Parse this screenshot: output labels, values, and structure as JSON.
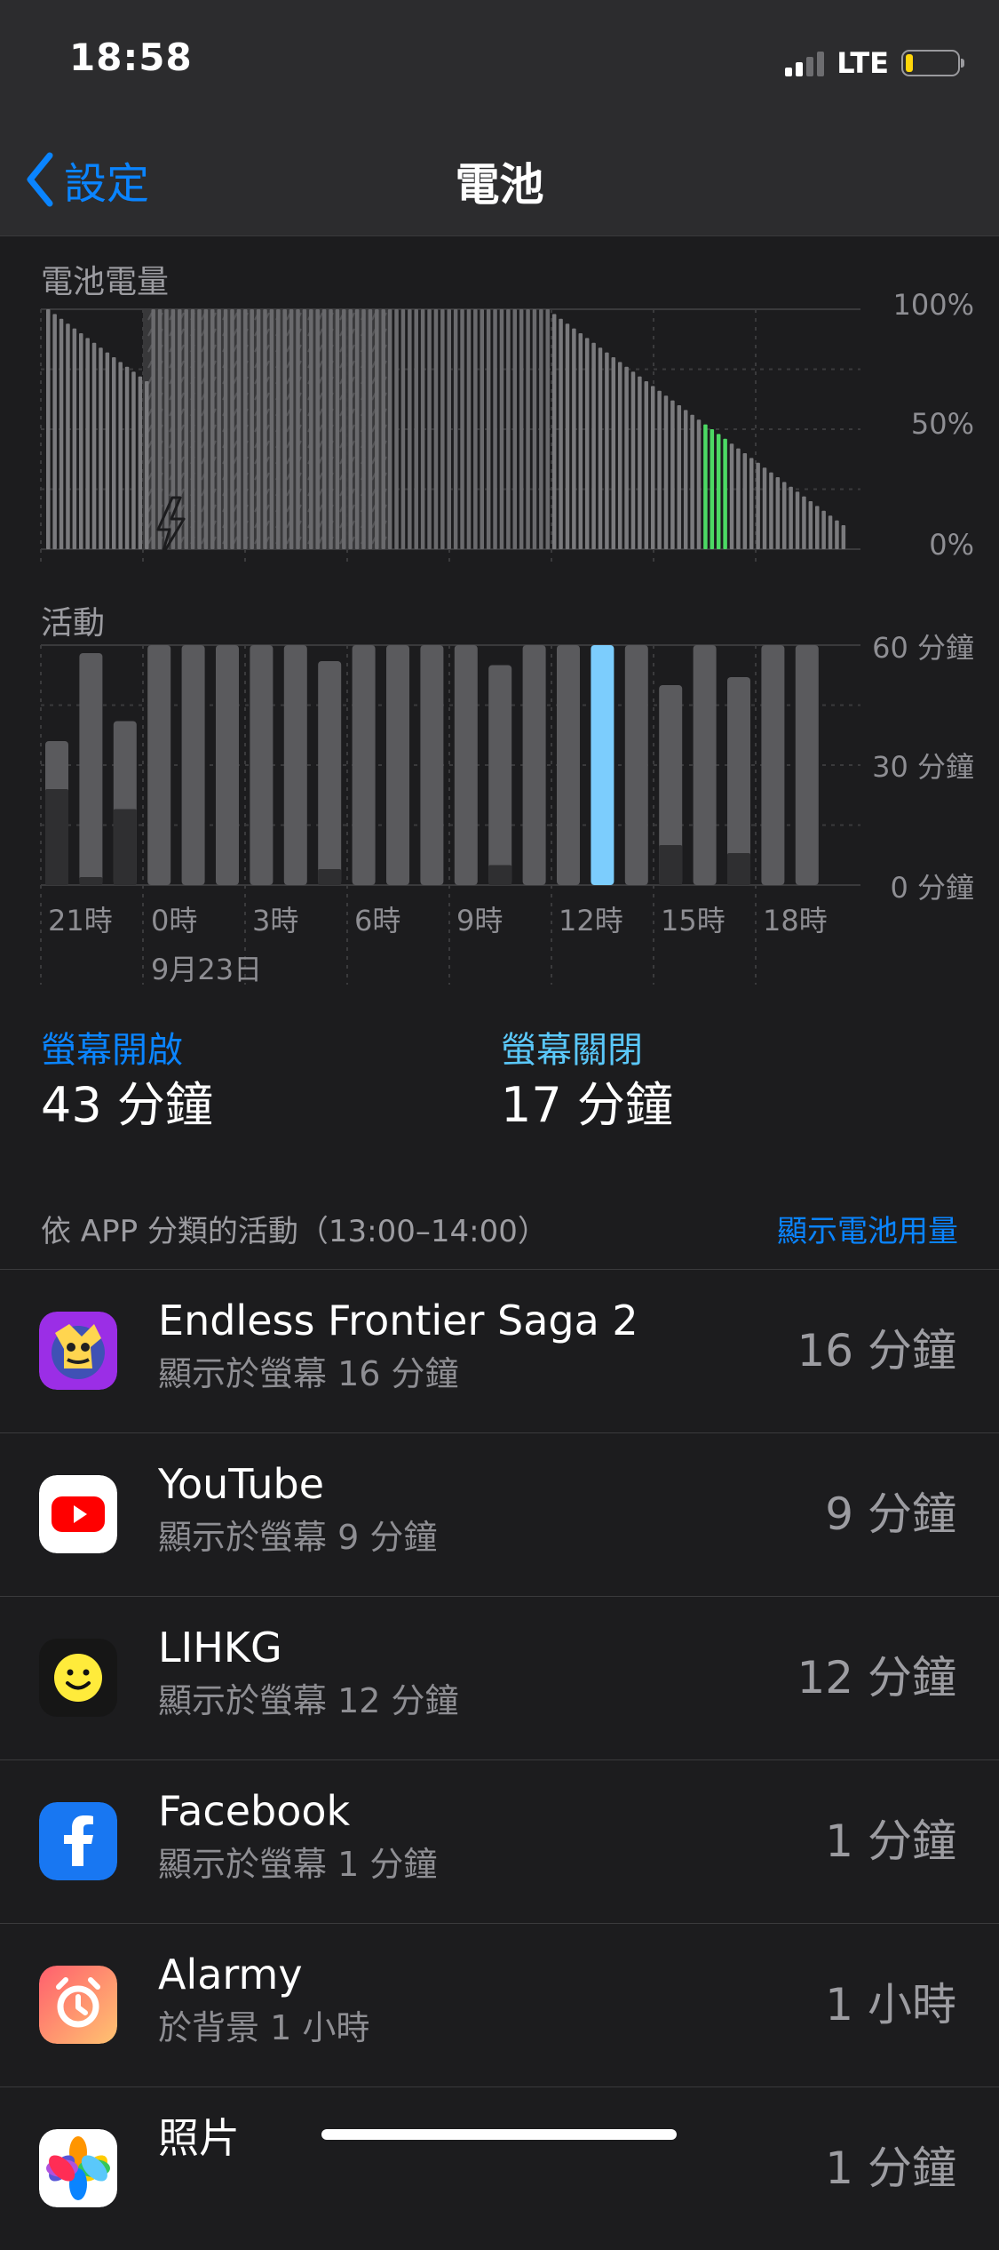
{
  "status": {
    "time": "18:58",
    "network": "LTE"
  },
  "nav": {
    "back_label": "設定",
    "title": "電池"
  },
  "sections": {
    "battery_label": "電池電量",
    "activity_label": "活動"
  },
  "battery_axis": [
    "100%",
    "50%",
    "0%"
  ],
  "activity_axis": [
    "60 分鐘",
    "30 分鐘",
    "0 分鐘"
  ],
  "x_axis": [
    "21時",
    "0時",
    "3時",
    "6時",
    "9時",
    "12時",
    "15時",
    "18時"
  ],
  "date_label": "9月23日",
  "screen": {
    "on_label": "螢幕開啟",
    "on_value": "43 分鐘",
    "off_label": "螢幕關閉",
    "off_value": "17 分鐘"
  },
  "apps_header": {
    "title": "依 APP 分類的活動（13:00–14:00）",
    "link": "顯示電池用量"
  },
  "apps": [
    {
      "name": "Endless Frontier Saga 2",
      "detail": "顯示於螢幕 16 分鐘",
      "value": "16 分鐘",
      "icon": "game-icon"
    },
    {
      "name": "YouTube",
      "detail": "顯示於螢幕 9 分鐘",
      "value": "9 分鐘",
      "icon": "youtube-icon"
    },
    {
      "name": "LIHKG",
      "detail": "顯示於螢幕 12 分鐘",
      "value": "12 分鐘",
      "icon": "lihkg-icon"
    },
    {
      "name": "Facebook",
      "detail": "顯示於螢幕 1 分鐘",
      "value": "1 分鐘",
      "icon": "facebook-icon"
    },
    {
      "name": "Alarmy",
      "detail": "於背景 1 小時",
      "value": "1 小時",
      "icon": "alarm-icon"
    },
    {
      "name": "照片",
      "detail": "",
      "value": "1 分鐘",
      "icon": "photos-icon"
    }
  ],
  "colors": {
    "accent": "#0a84ff",
    "screen_off": "#5ac8fa",
    "battery_highlight": "#4cd964",
    "activity_highlight": "#0a84ff"
  },
  "chart_data": [
    {
      "type": "bar",
      "title": "電池電量",
      "y_ticks": [
        "100%",
        "50%",
        "0%"
      ],
      "x_ticks": [
        "21時",
        "0時",
        "3時",
        "6時",
        "9時",
        "12時",
        "15時",
        "18時"
      ],
      "ylim": [
        0,
        100
      ],
      "values": [
        100,
        98,
        96,
        94,
        92,
        90,
        88,
        86,
        84,
        82,
        80,
        78,
        76,
        74,
        72,
        70,
        100,
        100,
        100,
        100,
        100,
        100,
        100,
        100,
        100,
        100,
        100,
        100,
        100,
        100,
        100,
        100,
        100,
        100,
        100,
        100,
        100,
        100,
        100,
        100,
        100,
        100,
        100,
        100,
        100,
        100,
        100,
        100,
        100,
        100,
        100,
        100,
        100,
        100,
        100,
        100,
        100,
        100,
        100,
        100,
        100,
        100,
        100,
        100,
        100,
        100,
        100,
        100,
        100,
        100,
        100,
        100,
        100,
        100,
        100,
        100,
        100,
        98,
        96,
        94,
        92,
        90,
        88,
        86,
        84,
        82,
        80,
        78,
        76,
        74,
        72,
        70,
        68,
        66,
        64,
        62,
        60,
        58,
        56,
        54,
        52,
        50,
        48,
        46,
        44,
        42,
        40,
        38,
        36,
        34,
        32,
        30,
        28,
        26,
        24,
        22,
        20,
        18,
        16,
        14,
        12,
        10
      ],
      "charging_range": [
        16,
        77
      ],
      "highlight_range": [
        100,
        104
      ]
    },
    {
      "type": "bar",
      "title": "活動",
      "y_ticks": [
        "60 分鐘",
        "30 分鐘",
        "0 分鐘"
      ],
      "x_ticks": [
        "21時",
        "0時",
        "3時",
        "6時",
        "9時",
        "12時",
        "15時",
        "18時"
      ],
      "ylim": [
        0,
        60
      ],
      "series": [
        {
          "values": [
            36,
            58,
            41,
            60,
            60,
            60,
            60,
            60,
            56,
            60,
            60,
            60,
            60,
            55,
            60,
            60,
            60,
            60,
            50,
            60,
            52,
            60,
            60
          ]
        },
        {
          "values": [
            24,
            2,
            19,
            0,
            0,
            0,
            0,
            0,
            4,
            0,
            0,
            0,
            0,
            5,
            0,
            0,
            0,
            0,
            10,
            0,
            8,
            0,
            0
          ]
        }
      ],
      "highlight_index": 16
    }
  ]
}
